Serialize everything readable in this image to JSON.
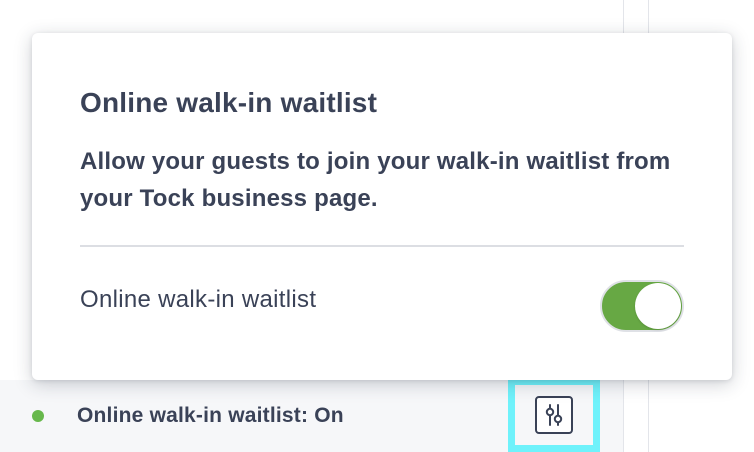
{
  "popover": {
    "title": "Online walk-in waitlist",
    "description": "Allow your guests to join your walk-in waitlist from your Tock business page.",
    "toggle_label": "Online walk-in waitlist",
    "toggle_on": true
  },
  "status_row": {
    "label": "Online walk-in waitlist: On",
    "indicator_color": "#67b84c"
  },
  "settings_button": {
    "icon": "sliders-icon",
    "highlight_color": "#6ff2fb"
  },
  "colors": {
    "text": "#3a4257",
    "toggle_on": "#67a844"
  }
}
